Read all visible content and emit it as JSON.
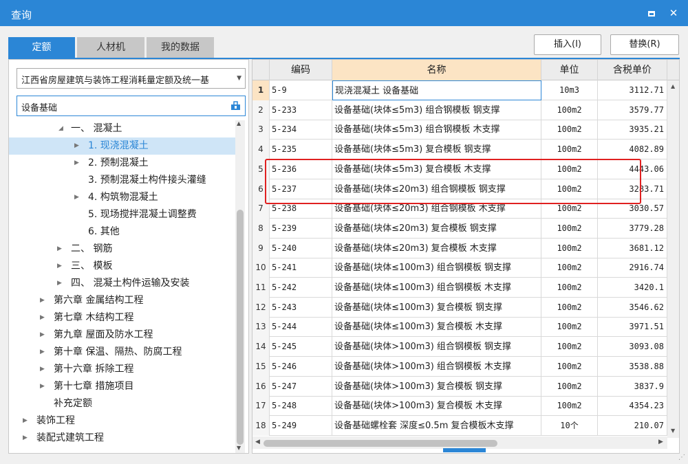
{
  "window": {
    "title": "查询"
  },
  "tabs": [
    "定额",
    "人材机",
    "我的数据"
  ],
  "buttons": {
    "insert": "插入(I)",
    "replace": "替换(R)"
  },
  "library_select": "江西省房屋建筑与装饰工程消耗量定额及统一基",
  "search_value": "设备基础",
  "tree": [
    {
      "label": "一、 混凝土",
      "expanded": true
    },
    {
      "label": "1. 现浇混凝土",
      "selected": true
    },
    {
      "label": "2. 预制混凝土"
    },
    {
      "label": "3. 预制混凝土构件接头灌缝"
    },
    {
      "label": "4. 构筑物混凝土"
    },
    {
      "label": "5. 现场搅拌混凝土调整费"
    },
    {
      "label": "6. 其他"
    },
    {
      "label": "二、 钢筋"
    },
    {
      "label": "三、 模板"
    },
    {
      "label": "四、 混凝土构件运输及安装"
    },
    {
      "label": "第六章 金属结构工程"
    },
    {
      "label": "第七章 木结构工程"
    },
    {
      "label": "第九章 屋面及防水工程"
    },
    {
      "label": "第十章 保温、隔热、防腐工程"
    },
    {
      "label": "第十六章 拆除工程"
    },
    {
      "label": "第十七章 措施项目"
    },
    {
      "label": "补充定额"
    },
    {
      "label": "装饰工程"
    },
    {
      "label": "装配式建筑工程"
    }
  ],
  "grid": {
    "columns": [
      "编码",
      "名称",
      "单位",
      "含税单价"
    ],
    "rows": [
      {
        "n": "1",
        "code": "5-9",
        "name": "现浇混凝土 设备基础",
        "unit": "10m3",
        "price": "3112.71"
      },
      {
        "n": "2",
        "code": "5-233",
        "name": "设备基础(块体≤5m3) 组合钢模板 钢支撑",
        "unit": "100m2",
        "price": "3579.77"
      },
      {
        "n": "3",
        "code": "5-234",
        "name": "设备基础(块体≤5m3) 组合钢模板 木支撑",
        "unit": "100m2",
        "price": "3935.21"
      },
      {
        "n": "4",
        "code": "5-235",
        "name": "设备基础(块体≤5m3) 复合模板 钢支撑",
        "unit": "100m2",
        "price": "4082.89"
      },
      {
        "n": "5",
        "code": "5-236",
        "name": "设备基础(块体≤5m3) 复合模板 木支撑",
        "unit": "100m2",
        "price": "4443.06"
      },
      {
        "n": "6",
        "code": "5-237",
        "name": "设备基础(块体≤20m3) 组合钢模板 钢支撑",
        "unit": "100m2",
        "price": "3283.71"
      },
      {
        "n": "7",
        "code": "5-238",
        "name": "设备基础(块体≤20m3) 组合钢模板 木支撑",
        "unit": "100m2",
        "price": "3030.57"
      },
      {
        "n": "8",
        "code": "5-239",
        "name": "设备基础(块体≤20m3) 复合模板 钢支撑",
        "unit": "100m2",
        "price": "3779.28"
      },
      {
        "n": "9",
        "code": "5-240",
        "name": "设备基础(块体≤20m3) 复合模板 木支撑",
        "unit": "100m2",
        "price": "3681.12"
      },
      {
        "n": "10",
        "code": "5-241",
        "name": "设备基础(块体≤100m3) 组合钢模板 钢支撑",
        "unit": "100m2",
        "price": "2916.74"
      },
      {
        "n": "11",
        "code": "5-242",
        "name": "设备基础(块体≤100m3) 组合钢模板 木支撑",
        "unit": "100m2",
        "price": "3420.1"
      },
      {
        "n": "12",
        "code": "5-243",
        "name": "设备基础(块体≤100m3) 复合模板 钢支撑",
        "unit": "100m2",
        "price": "3546.62"
      },
      {
        "n": "13",
        "code": "5-244",
        "name": "设备基础(块体≤100m3) 复合模板 木支撑",
        "unit": "100m2",
        "price": "3971.51"
      },
      {
        "n": "14",
        "code": "5-245",
        "name": "设备基础(块体>100m3) 组合钢模板 钢支撑",
        "unit": "100m2",
        "price": "3093.08"
      },
      {
        "n": "15",
        "code": "5-246",
        "name": "设备基础(块体>100m3) 组合钢模板 木支撑",
        "unit": "100m2",
        "price": "3538.88"
      },
      {
        "n": "16",
        "code": "5-247",
        "name": "设备基础(块体>100m3) 复合模板 钢支撑",
        "unit": "100m2",
        "price": "3837.9"
      },
      {
        "n": "17",
        "code": "5-248",
        "name": "设备基础(块体>100m3) 复合模板 木支撑",
        "unit": "100m2",
        "price": "4354.23"
      },
      {
        "n": "18",
        "code": "5-249",
        "name": "设备基础螺栓套 深度≤0.5m 复合模板木支撑",
        "unit": "10个",
        "price": "210.07"
      }
    ]
  },
  "colors": {
    "accent": "#2b86d6",
    "highlight_box": "#e02020",
    "name_header": "#fce4c4"
  }
}
